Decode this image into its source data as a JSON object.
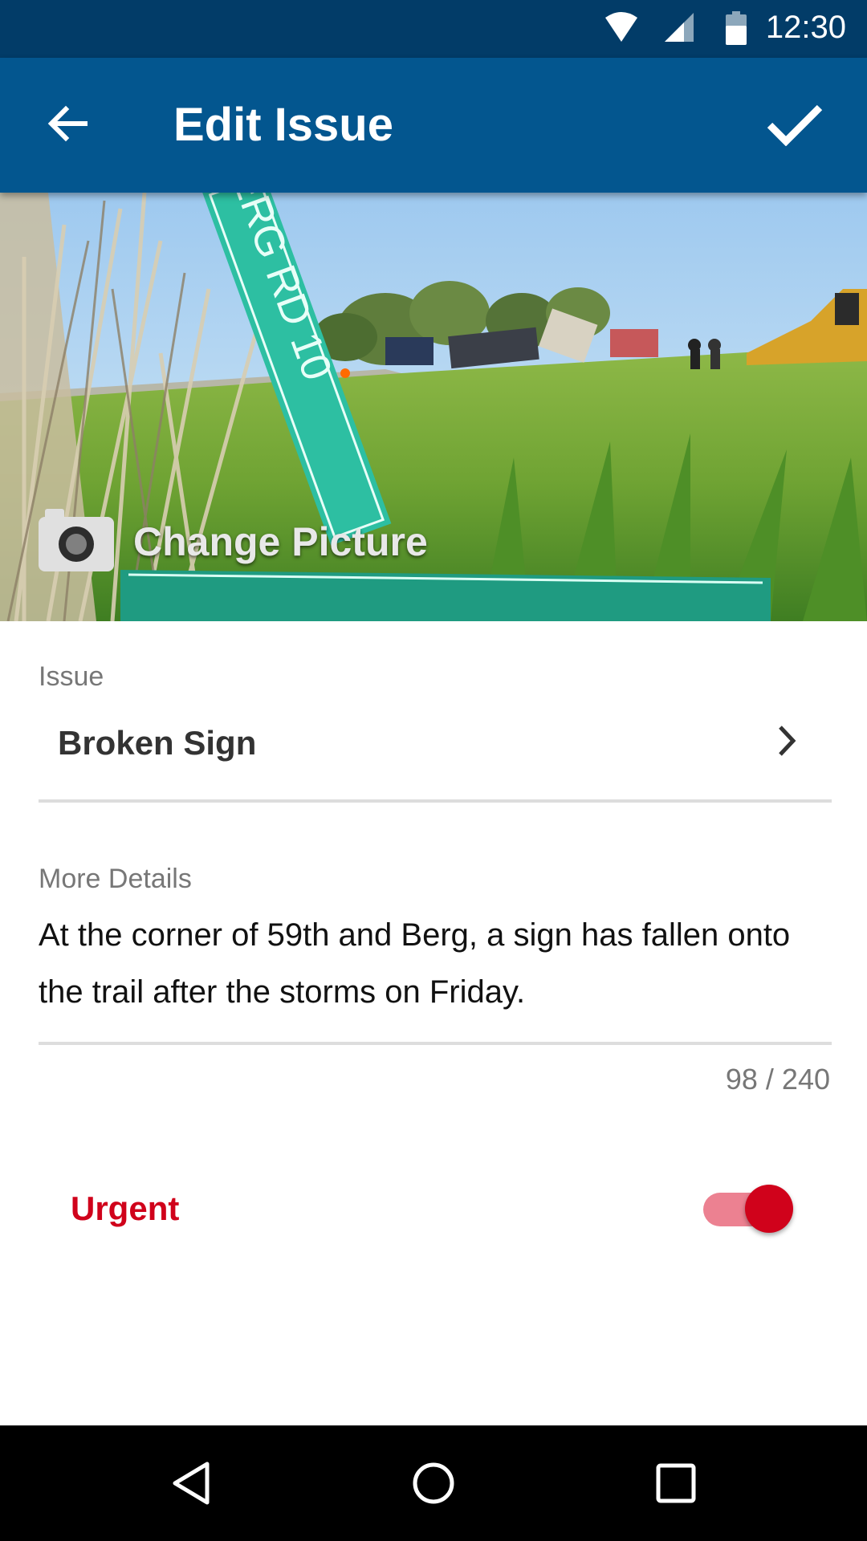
{
  "status_bar": {
    "time": "12:30",
    "icons": [
      "wifi-icon",
      "signal-icon",
      "battery-icon"
    ]
  },
  "app_bar": {
    "title": "Edit Issue",
    "back_icon": "arrow-back-icon",
    "confirm_icon": "check-icon",
    "background_color": "#03568f",
    "status_color": "#023c68"
  },
  "photo": {
    "change_label": "Change Picture",
    "camera_icon": "camera-icon"
  },
  "form": {
    "issue_label": "Issue",
    "issue_value": "Broken Sign",
    "details_label": "More Details",
    "details_value": "At the corner of 59th and Berg, a sign has fallen onto the trail after the storms on Friday.",
    "counter": "98 / 240",
    "urgent_label": "Urgent",
    "urgent_on": true,
    "accent_color": "#d0021b"
  },
  "nav_bar": {
    "icons": [
      "nav-back-icon",
      "nav-home-icon",
      "nav-recents-icon"
    ]
  }
}
